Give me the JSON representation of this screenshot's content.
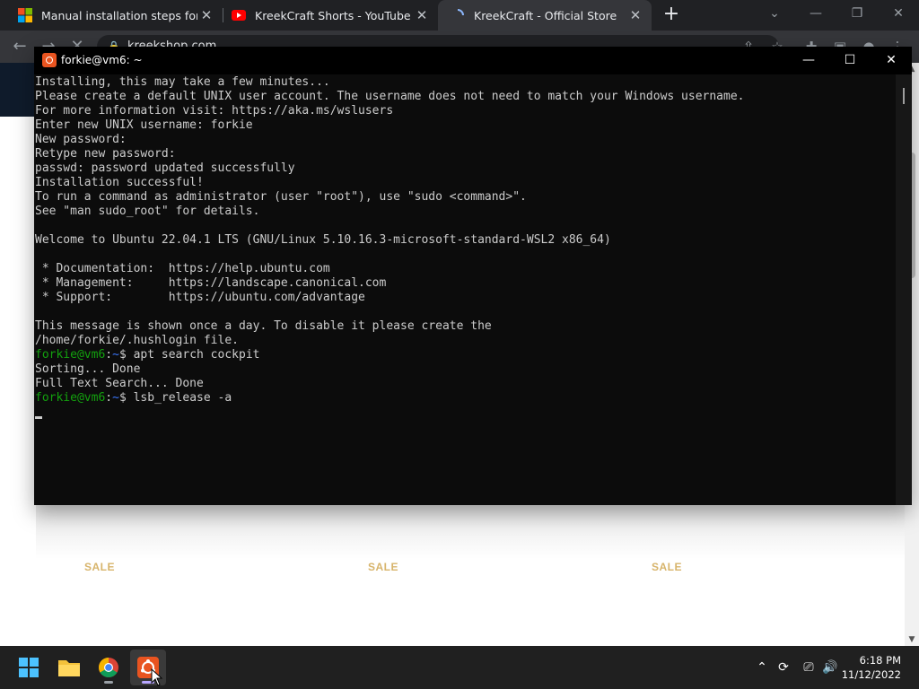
{
  "browser": {
    "tabs": [
      {
        "title": "Manual installation steps for olde",
        "icon": "microsoft-icon",
        "active": false
      },
      {
        "title": "KreekCraft Shorts - YouTube",
        "icon": "youtube-icon",
        "active": false
      },
      {
        "title": "KreekCraft - Official Store",
        "icon": "loading-icon",
        "active": true
      }
    ],
    "new_tab_label": "+",
    "address": "kreekshop.com"
  },
  "page": {
    "sale_labels": [
      "SALE",
      "SALE",
      "SALE"
    ]
  },
  "terminal": {
    "title": "forkie@vm6: ~",
    "lines": [
      {
        "text": "Installing, this may take a few minutes..."
      },
      {
        "text": "Please create a default UNIX user account. The username does not need to match your Windows username."
      },
      {
        "text": "For more information visit: https://aka.ms/wslusers"
      },
      {
        "text": "Enter new UNIX username: forkie"
      },
      {
        "text": "New password:"
      },
      {
        "text": "Retype new password:"
      },
      {
        "text": "passwd: password updated successfully"
      },
      {
        "text": "Installation successful!"
      },
      {
        "text": "To run a command as administrator (user \"root\"), use \"sudo <command>\"."
      },
      {
        "text": "See \"man sudo_root\" for details."
      },
      {
        "text": ""
      },
      {
        "text": "Welcome to Ubuntu 22.04.1 LTS (GNU/Linux 5.10.16.3-microsoft-standard-WSL2 x86_64)"
      },
      {
        "text": ""
      },
      {
        "text": " * Documentation:  https://help.ubuntu.com"
      },
      {
        "text": " * Management:     https://landscape.canonical.com"
      },
      {
        "text": " * Support:        https://ubuntu.com/advantage"
      },
      {
        "text": ""
      },
      {
        "text": "This message is shown once a day. To disable it please create the"
      },
      {
        "text": "/home/forkie/.hushlogin file."
      },
      {
        "prompt_user": "forkie@vm6",
        "prompt_path": "~",
        "command": "apt search cockpit"
      },
      {
        "text": "Sorting... Done"
      },
      {
        "text": "Full Text Search... Done"
      },
      {
        "prompt_user": "forkie@vm6",
        "prompt_path": "~",
        "command": "lsb_release -a"
      }
    ],
    "colors": {
      "background": "#0c0c0c",
      "text": "#cccccc",
      "prompt_user": "#13a10e",
      "prompt_path": "#3b78ff"
    }
  },
  "taskbar": {
    "apps": [
      {
        "name": "start-button",
        "icon": "windows-logo-icon"
      },
      {
        "name": "file-explorer",
        "icon": "folder-icon"
      },
      {
        "name": "chrome",
        "icon": "chrome-icon"
      },
      {
        "name": "ubuntu-terminal",
        "icon": "ubuntu-icon",
        "active": true
      }
    ],
    "time": "6:18 PM",
    "date": "11/12/2022"
  }
}
